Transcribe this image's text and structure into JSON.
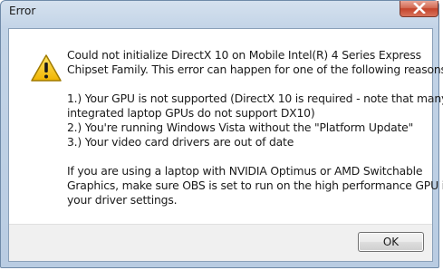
{
  "window": {
    "title": "Error"
  },
  "icons": {
    "close": "close-icon",
    "warning": "warning-icon"
  },
  "message": {
    "lines": [
      "Could not initialize DirectX 10 on Mobile Intel(R) 4 Series Express",
      "Chipset Family.  This error can happen for one of the following reasons:",
      "",
      "1.) Your GPU is not supported (DirectX 10 is required - note that many",
      "integrated laptop GPUs do not support DX10)",
      "2.) You're running Windows Vista without the \"Platform Update\"",
      "3.) Your video card drivers are out of date",
      "",
      "If you are using a laptop with NVIDIA Optimus or AMD Switchable",
      "Graphics, make sure OBS is set to run on the high performance GPU in",
      "your driver settings."
    ]
  },
  "buttons": {
    "ok_label": "OK"
  },
  "colors": {
    "warning_fill": "#f5c400",
    "warning_border": "#b08a00",
    "close_red": "#c4432a"
  }
}
